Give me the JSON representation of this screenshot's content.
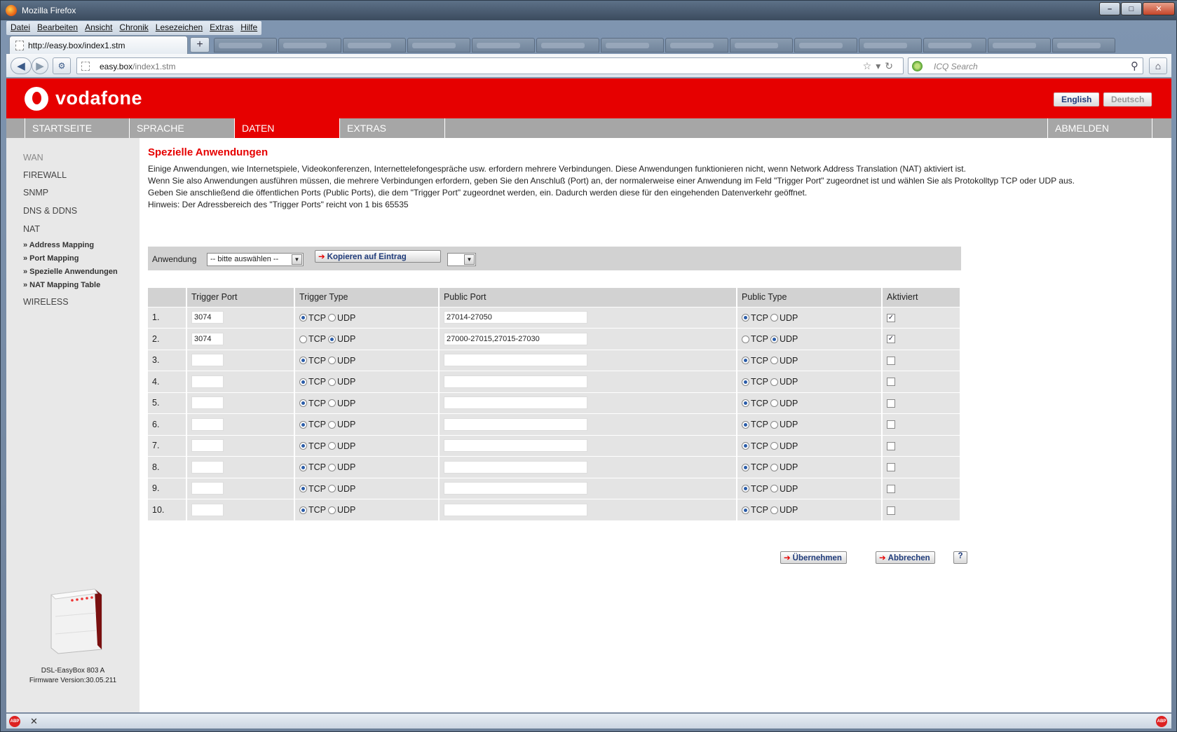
{
  "window": {
    "title": "Mozilla Firefox"
  },
  "menu": [
    "Datei",
    "Bearbeiten",
    "Ansicht",
    "Chronik",
    "Lesezeichen",
    "Extras",
    "Hilfe"
  ],
  "tab": {
    "title": "http://easy.box/index1.stm",
    "new_tab": "+"
  },
  "address": {
    "host": "easy.box",
    "path": "/index1.stm"
  },
  "search": {
    "placeholder": "ICQ Search"
  },
  "brand": {
    "name": "vodafone"
  },
  "language": {
    "english": "English",
    "deutsch": "Deutsch"
  },
  "nav": {
    "start": "STARTSEITE",
    "language": "SPRACHE",
    "data": "DATEN",
    "extras": "EXTRAS",
    "logout": "ABMELDEN"
  },
  "sidebar": {
    "items": [
      "WAN",
      "FIREWALL",
      "SNMP",
      "DNS & DDNS",
      "NAT"
    ],
    "sub_items": [
      "» Address Mapping",
      "» Port Mapping",
      "» Spezielle Anwendungen",
      "» NAT Mapping Table"
    ],
    "wireless": "WIRELESS",
    "device_name": "DSL-EasyBox 803 A",
    "firmware": "Firmware Version:30.05.211"
  },
  "page": {
    "heading": "Spezielle Anwendungen",
    "desc1": "Einige Anwendungen, wie Internetspiele, Videokonferenzen, Internettelefongespräche usw. erfordern mehrere Verbindungen. Diese Anwendungen funktionieren nicht, wenn Network Address Translation (NAT) aktiviert ist.",
    "desc2": "Wenn Sie also Anwendungen ausführen müssen, die mehrere Verbindungen erfordern, geben Sie den Anschluß (Port) an, der normalerweise einer Anwendung im Feld \"Trigger Port\" zugeordnet ist und wählen Sie als Protokolltyp TCP oder UDP aus.",
    "desc3": "Geben Sie anschließend die öffentlichen Ports (Public Ports), die dem \"Trigger Port\" zugeordnet werden, ein. Dadurch werden diese für den eingehenden Datenverkehr geöffnet.",
    "desc4": "Hinweis: Der Adressbereich des \"Trigger Ports\" reicht von 1 bis 65535",
    "app_label": "Anwendung",
    "app_select": "-- bitte auswählen --",
    "copy_button": "Kopieren auf Eintrag",
    "entry_select": ""
  },
  "table": {
    "headers": [
      "",
      "Trigger Port",
      "Trigger Type",
      "Public Port",
      "Public Type",
      "Aktiviert"
    ],
    "tcp": "TCP",
    "udp": "UDP",
    "rows": [
      {
        "n": "1.",
        "trigger": "3074",
        "ttype": "TCP",
        "public": "27014-27050",
        "ptype": "TCP",
        "active": true
      },
      {
        "n": "2.",
        "trigger": "3074",
        "ttype": "UDP",
        "public": "27000-27015,27015-27030",
        "ptype": "UDP",
        "active": true
      },
      {
        "n": "3.",
        "trigger": "",
        "ttype": "TCP",
        "public": "",
        "ptype": "TCP",
        "active": false
      },
      {
        "n": "4.",
        "trigger": "",
        "ttype": "TCP",
        "public": "",
        "ptype": "TCP",
        "active": false
      },
      {
        "n": "5.",
        "trigger": "",
        "ttype": "TCP",
        "public": "",
        "ptype": "TCP",
        "active": false
      },
      {
        "n": "6.",
        "trigger": "",
        "ttype": "TCP",
        "public": "",
        "ptype": "TCP",
        "active": false
      },
      {
        "n": "7.",
        "trigger": "",
        "ttype": "TCP",
        "public": "",
        "ptype": "TCP",
        "active": false
      },
      {
        "n": "8.",
        "trigger": "",
        "ttype": "TCP",
        "public": "",
        "ptype": "TCP",
        "active": false
      },
      {
        "n": "9.",
        "trigger": "",
        "ttype": "TCP",
        "public": "",
        "ptype": "TCP",
        "active": false
      },
      {
        "n": "10.",
        "trigger": "",
        "ttype": "TCP",
        "public": "",
        "ptype": "TCP",
        "active": false
      }
    ]
  },
  "buttons": {
    "apply": "Übernehmen",
    "cancel": "Abbrechen",
    "help": "?"
  },
  "colors": {
    "brand_red": "#e60000",
    "nav_gray": "#a6a6a6",
    "button_text": "#1f3b7a"
  },
  "icons": [
    "firefox-icon",
    "back-icon",
    "forward-icon",
    "star-icon",
    "reload-icon",
    "search-icon",
    "home-icon",
    "adblock-icon"
  ]
}
